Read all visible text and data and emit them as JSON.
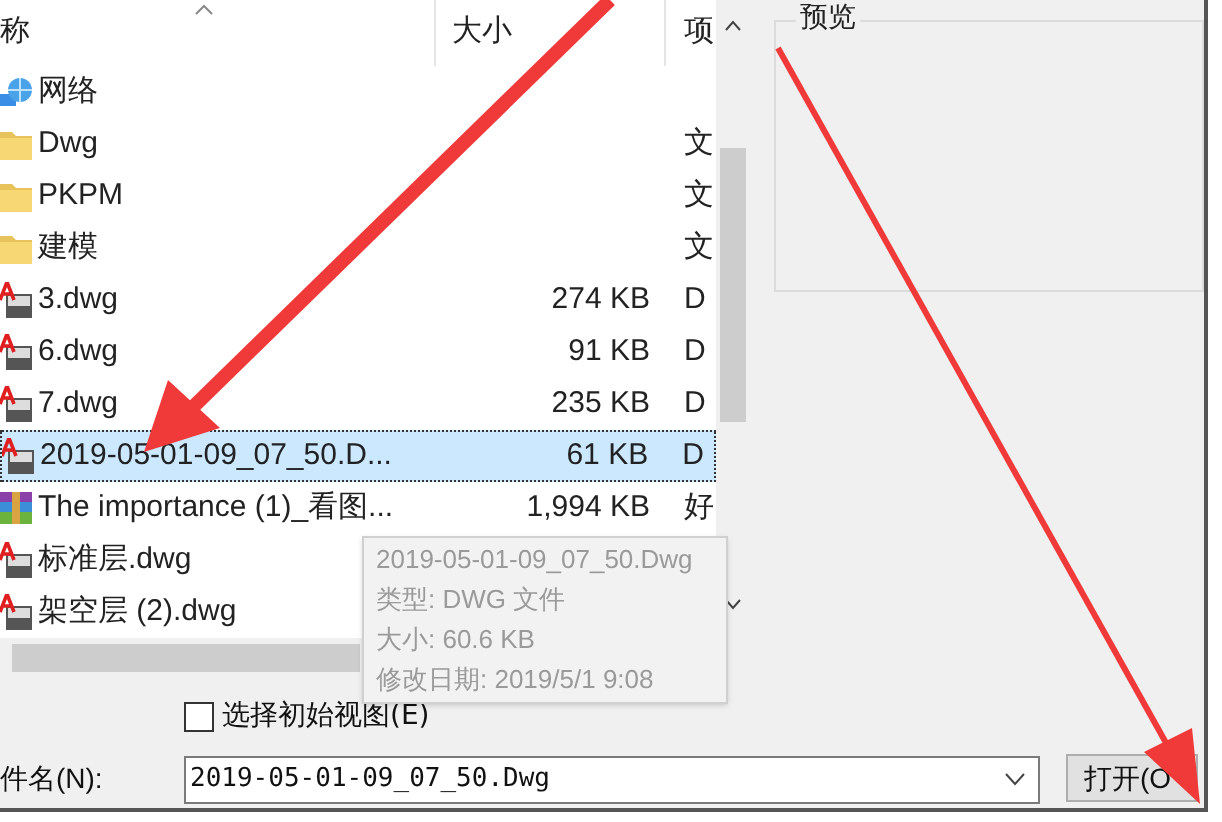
{
  "columns": [
    {
      "label": "称"
    },
    {
      "label": "大小"
    },
    {
      "label": "项"
    }
  ],
  "rows": [
    {
      "kind": "network",
      "name": "网络",
      "selected": false
    },
    {
      "kind": "folder",
      "name": "Dwg",
      "type": "文",
      "selected": false
    },
    {
      "kind": "folder",
      "name": "PKPM",
      "type": "文",
      "selected": false
    },
    {
      "kind": "folder",
      "name": "建模",
      "type": "文",
      "selected": false
    },
    {
      "kind": "dwg",
      "name": "3.dwg",
      "size": "274 KB",
      "type": "D",
      "selected": false
    },
    {
      "kind": "dwg",
      "name": "6.dwg",
      "size": "91 KB",
      "type": "D",
      "selected": false
    },
    {
      "kind": "dwg",
      "name": "7.dwg",
      "size": "235 KB",
      "type": "D",
      "selected": false
    },
    {
      "kind": "dwg",
      "name": "2019-05-01-09_07_50.D...",
      "size": "61 KB",
      "type": "D",
      "selected": true
    },
    {
      "kind": "archive",
      "name": "The importance (1)_看图...",
      "size": "1,994 KB",
      "type": "好",
      "selected": false
    },
    {
      "kind": "dwg",
      "name": "标准层.dwg",
      "selected": false
    },
    {
      "kind": "dwg",
      "name": "架空层 (2).dwg",
      "selected": false
    }
  ],
  "tooltip": [
    "2019-05-01-09_07_50.Dwg",
    "类型: DWG 文件",
    "大小: 60.6 KB",
    "修改日期: 2019/5/1 9:08"
  ],
  "preview": {
    "title": "预览"
  },
  "initial_view": {
    "label": "选择初始视图(E)",
    "checked": false
  },
  "file_name": {
    "label": "件名(N):",
    "value": "2019-05-01-09_07_50.Dwg"
  },
  "open_button": "打开(O"
}
